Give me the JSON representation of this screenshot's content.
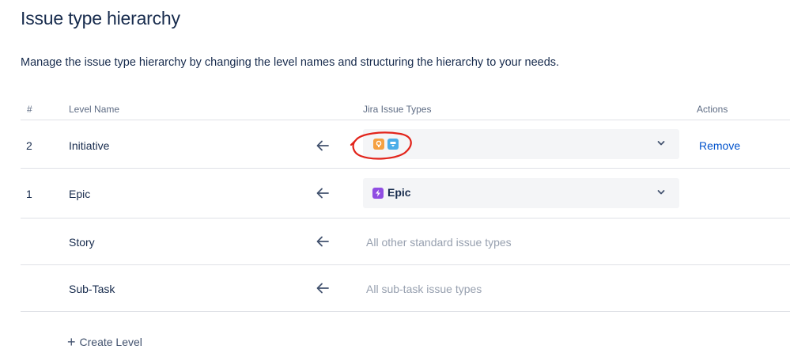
{
  "page": {
    "title": "Issue type hierarchy",
    "description": "Manage the issue type hierarchy by changing the level names and structuring the hierarchy to your needs."
  },
  "table": {
    "headers": {
      "number": "#",
      "level_name": "Level Name",
      "issue_types": "Jira Issue Types",
      "actions": "Actions"
    },
    "rows": [
      {
        "number": "2",
        "name": "Initiative",
        "issue_types": {
          "kind": "select",
          "icons": [
            "idea-icon",
            "info-card-icon"
          ],
          "value": ""
        },
        "action": "Remove"
      },
      {
        "number": "1",
        "name": "Epic",
        "issue_types": {
          "kind": "select",
          "icons": [
            "lightning-icon"
          ],
          "value": "Epic"
        },
        "action": ""
      },
      {
        "number": "",
        "name": "Story",
        "issue_types": {
          "kind": "text",
          "value": "All other standard issue types"
        },
        "action": ""
      },
      {
        "number": "",
        "name": "Sub-Task",
        "issue_types": {
          "kind": "text",
          "value": "All sub-task issue types"
        },
        "action": ""
      }
    ]
  },
  "create_level": {
    "label": "Create Level"
  },
  "colors": {
    "text": "#172b4d",
    "muted": "#97a0af",
    "link": "#0052cc",
    "select_bg": "#f4f5f7",
    "annotation": "#e2231a",
    "icon_orange": "#f5a142",
    "icon_blue": "#4bade8",
    "icon_purple": "#904ee2"
  }
}
